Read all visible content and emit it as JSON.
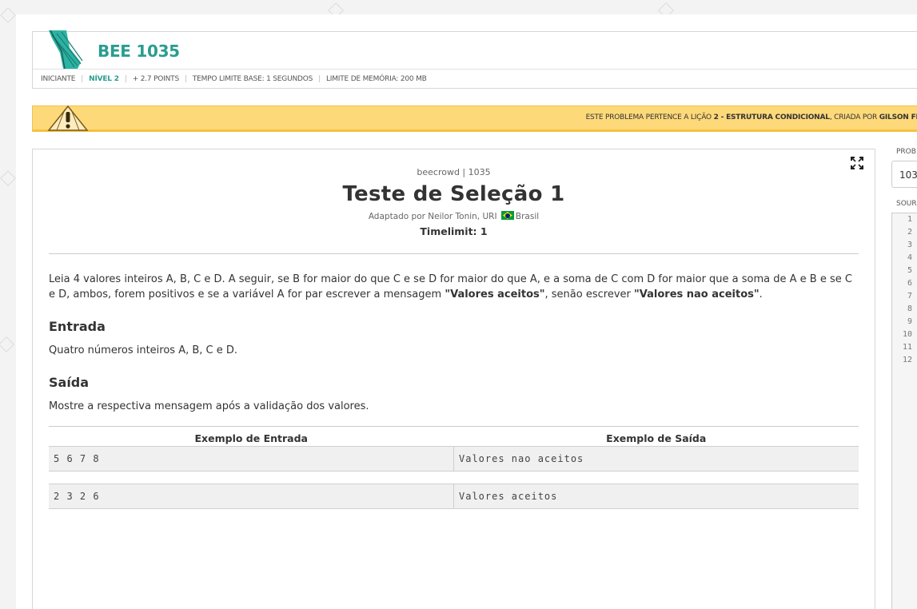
{
  "header": {
    "title": "BEE 1035",
    "meta": {
      "category": "INICIANTE",
      "level": "NÍVEL 2",
      "points": "+ 2.7 POINTS",
      "time_limit": "TEMPO LIMITE BASE: 1 SEGUNDOS",
      "memory_limit": "LIMITE DE MEMÓRIA: 200 MB"
    }
  },
  "banner": {
    "prefix": "ESTE PROBLEMA PERTENCE A LIÇÃO ",
    "lesson": "2 - ESTRUTURA CONDICIONAL",
    "middle": ", CRIADA POR ",
    "author": "GILSON FILHO"
  },
  "problem": {
    "breadcrumb": "beecrowd | 1035",
    "title": "Teste de Seleção 1",
    "adapted_by": "Adaptado por Neilor Tonin, URI",
    "country": "Brasil",
    "timelimit": "Timelimit: 1",
    "description_part1": "Leia 4 valores inteiros A, B, C e D. A seguir, se B for maior do que C e se D for maior do que A, e a soma de C com D for maior que a soma de A e B e se C e D, ambos, forem positivos e se a variável A for par escrever a mensagem ",
    "msg_accepted": "\"Valores aceitos\"",
    "description_part2": ", senão escrever ",
    "msg_rejected": "\"Valores nao aceitos\"",
    "description_part3": ".",
    "input_heading": "Entrada",
    "input_text": "Quatro números inteiros A, B, C e D.",
    "output_heading": "Saída",
    "output_text": "Mostre a respectiva mensagem após a validação dos valores.",
    "examples": {
      "header_input": "Exemplo de Entrada",
      "header_output": "Exemplo de Saída",
      "rows": [
        {
          "input": "5 6 7 8",
          "output": "Valores nao aceitos"
        },
        {
          "input": "2 3 2 6",
          "output": "Valores aceitos"
        }
      ]
    }
  },
  "side_panel": {
    "problem_label": "PROB",
    "problem_value": "103",
    "source_label": "SOUR",
    "line_numbers": [
      "1",
      "2",
      "3",
      "4",
      "5",
      "6",
      "7",
      "8",
      "9",
      "10",
      "11",
      "12"
    ]
  },
  "icons": {
    "logo": "balloon-logo-icon",
    "warning": "warning-icon",
    "expand": "expand-icon",
    "flag": "brazil-flag-icon"
  },
  "colors": {
    "accent": "#2a9d8f",
    "banner": "#fed97a"
  }
}
